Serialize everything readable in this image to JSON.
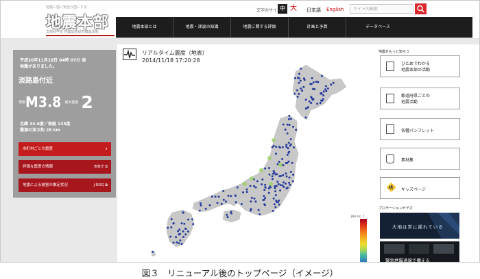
{
  "header": {
    "logo_tagline": "地震に強い安全な国にする",
    "logo_text": "地震本部",
    "logo_sub": "文部科学省 地震調査研究推進本部",
    "font_size_label": "文字のサイズ",
    "font_size_medium": "中",
    "font_size_large": "大",
    "lang_ja": "日本語",
    "lang_en": "English",
    "search_placeholder": "サイト内検索",
    "nav": [
      "地震本部とは",
      "地震・津波の知識",
      "地震に関する評価",
      "計画と予算",
      "データベース"
    ]
  },
  "quake_panel": {
    "line1": "平成26年11月18日 04時 07分 頃",
    "line2": "地震がありました。",
    "location": "淡路島付近",
    "magnitude_label": "規模",
    "magnitude": "M3.8",
    "intensity_label": "最大震度",
    "intensity": "2",
    "latlon": "北緯 34.6度／東経 135度",
    "depth": "震源の深さ約 28 km",
    "buttons": [
      {
        "label": "市町村ごとの震度",
        "right": "›"
      },
      {
        "label": "評価な震度の情報",
        "right": "気象庁 ⧉"
      },
      {
        "label": "地震による被害の推定状況",
        "right": "J-RISQ ⧉"
      }
    ]
  },
  "map": {
    "title": "リアルタイム震度（地表）",
    "time": "2014/11/18 17:20:28",
    "jma_label": "JMA Int. 7"
  },
  "right_panel": {
    "title": "地震をもっと知ろう",
    "buttons": [
      {
        "line1": "ひとめでわかる",
        "line2": "地震本部の活動"
      },
      {
        "line1": "都道府県ごとの",
        "line2": "地震活動"
      },
      {
        "line1": "各種パンフレット",
        "line2": ""
      },
      {
        "line1": "素材集",
        "line2": ""
      },
      {
        "line1": "キッズページ",
        "line2": ""
      }
    ],
    "promo_label": "プロモーションビデオ",
    "video1_text": "大地は常に揺れている",
    "video2_text": "緊急地震速報で備える"
  },
  "caption": "図３　リニューアル後のトップページ（イメージ）",
  "colors": {
    "accent": "#d9282f",
    "nav_bg": "#1d1d1d",
    "panel_grey": "#9e9e9e",
    "station_dot": "#283c9c",
    "land": "#c8c8c8"
  }
}
